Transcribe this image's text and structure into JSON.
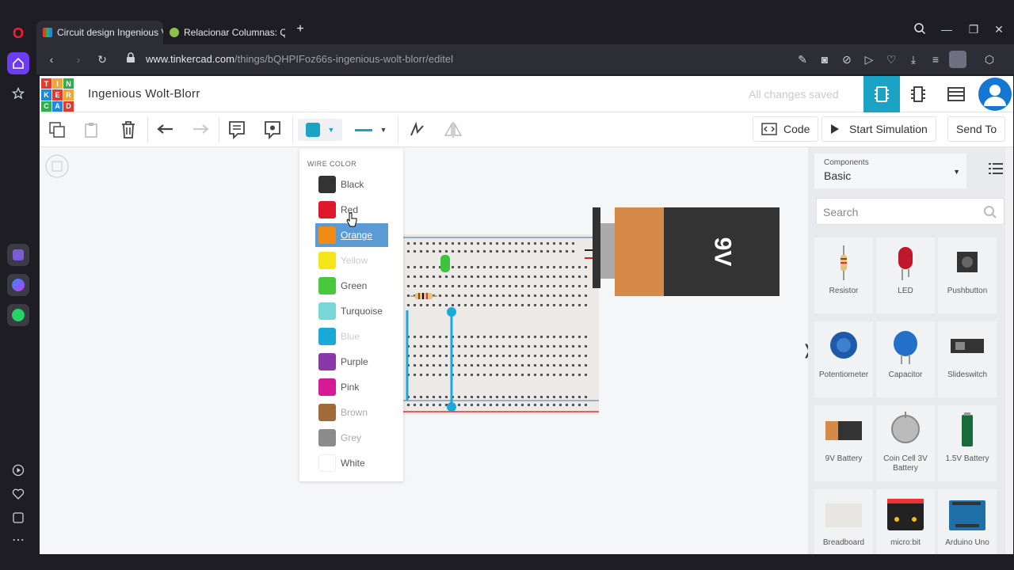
{
  "browser": {
    "tabs": [
      {
        "label": "Circuit design Ingenious V",
        "active": true
      },
      {
        "label": "Relacionar Columnas: Qui",
        "active": false
      }
    ],
    "new_tab": "+",
    "url_main": "www.tinkercad.com",
    "url_path": "/things/bQHPIFoz66s-ingenious-wolt-blorr/editel"
  },
  "app": {
    "logo_letters": [
      "T",
      "I",
      "N",
      "K",
      "E",
      "R",
      "C",
      "A",
      "D"
    ],
    "title": "Ingenious Wolt-Blorr",
    "saved_status": "All changes saved"
  },
  "toolbar": {
    "code_label": "Code",
    "start_sim_label": "Start Simulation",
    "send_to_label": "Send To"
  },
  "wire_color_menu": {
    "title": "WIRE COLOR",
    "items": [
      {
        "label": "Black",
        "color": "#333333"
      },
      {
        "label": "Red",
        "color": "#e0182d"
      },
      {
        "label": "Orange",
        "color": "#f08a14",
        "selected": true
      },
      {
        "label": "Yellow",
        "color": "#f5e61a"
      },
      {
        "label": "Green",
        "color": "#48c83c"
      },
      {
        "label": "Turquoise",
        "color": "#78d6d6"
      },
      {
        "label": "Blue",
        "color": "#1aa9d8"
      },
      {
        "label": "Purple",
        "color": "#8a37a7"
      },
      {
        "label": "Pink",
        "color": "#d61a96"
      },
      {
        "label": "Brown",
        "color": "#a06a3a"
      },
      {
        "label": "Grey",
        "color": "#8c8c8c"
      },
      {
        "label": "White",
        "color": "#ffffff"
      }
    ]
  },
  "battery_label": "9V",
  "components_panel": {
    "label": "Components",
    "value": "Basic",
    "search_placeholder": "Search",
    "items": [
      {
        "label": "Resistor"
      },
      {
        "label": "LED"
      },
      {
        "label": "Pushbutton"
      },
      {
        "label": "Potentiometer"
      },
      {
        "label": "Capacitor"
      },
      {
        "label": "Slideswitch"
      },
      {
        "label": "9V Battery"
      },
      {
        "label": "Coin Cell 3V Battery"
      },
      {
        "label": "1.5V Battery"
      },
      {
        "label": "Breadboard"
      },
      {
        "label": "micro:bit"
      },
      {
        "label": "Arduino Uno"
      }
    ]
  },
  "colors": {
    "accent": "#1ba3c5",
    "tinkercad_blue": "#1477d4"
  }
}
